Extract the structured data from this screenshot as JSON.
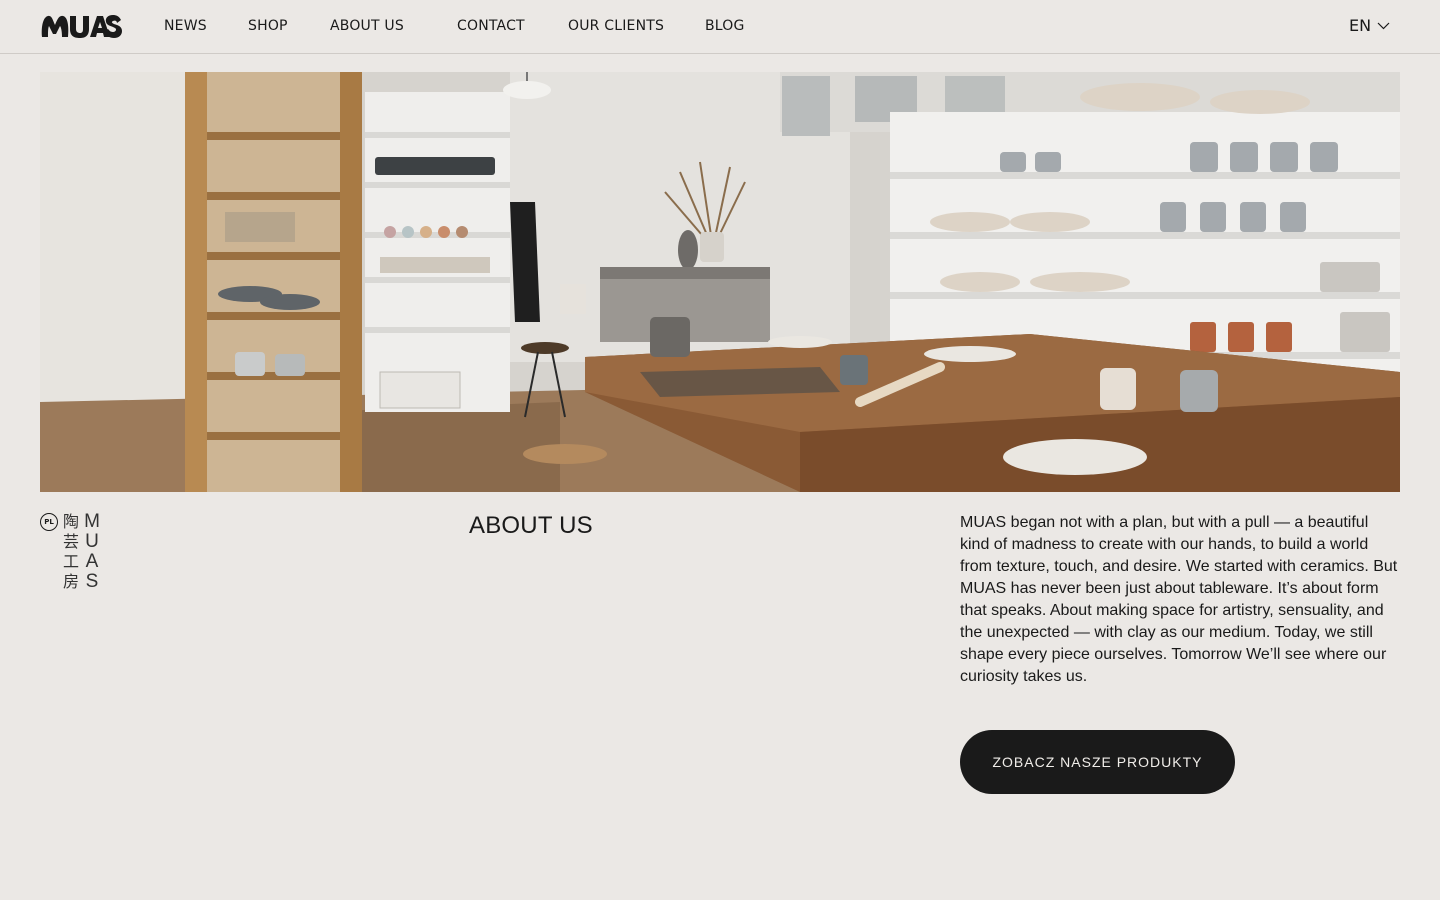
{
  "brand": {
    "logo_text": "MUAS"
  },
  "nav": {
    "items": [
      {
        "label": "NEWS"
      },
      {
        "label": "SHOP"
      },
      {
        "label": "ABOUT US"
      },
      {
        "label": "CONTACT"
      },
      {
        "label": "OUR CLIENTS"
      },
      {
        "label": "BLOG"
      }
    ],
    "language": "EN"
  },
  "mark": {
    "badge": "PL",
    "kanji": [
      "陶",
      "芸",
      "工",
      "房"
    ],
    "latin": [
      "M",
      "U",
      "A",
      "S"
    ]
  },
  "about": {
    "title": "ABOUT US",
    "text": "MUAS began not with a plan, but with a pull — a beautiful kind of madness to create with our hands, to build a world from texture, touch, and desire. We started with ceramics. But MUAS has never been just about tableware. It’s about form that speaks. About making space for artistry, sensuality, and the unexpected — with clay as our medium. Today, we still shape every piece ourselves. Tomorrow We’ll see where our curiosity takes us.",
    "cta_label": "ZOBACZ  NASZE  PRODUKTY"
  },
  "colors": {
    "background": "#ebe8e5",
    "text": "#1a1a1a",
    "button_bg": "#1a1a1a",
    "button_text": "#f0ede9"
  },
  "icons": {
    "language_dropdown": "chevron-down-icon",
    "hero": "ceramics-studio-photo"
  }
}
